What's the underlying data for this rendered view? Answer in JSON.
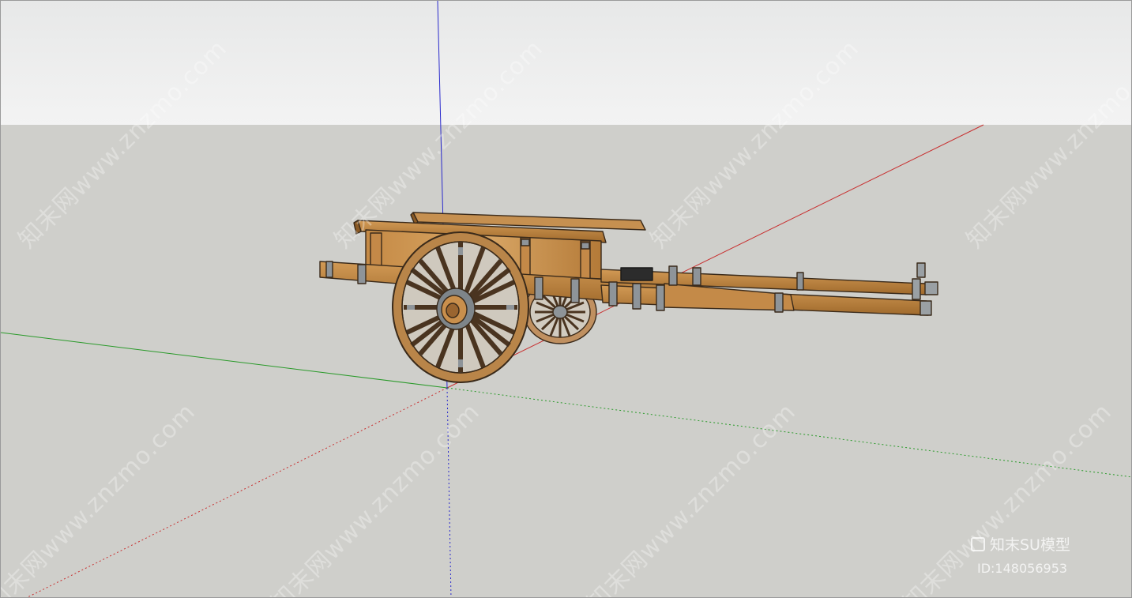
{
  "viewport": {
    "sky_color": "#eeeeee",
    "ground_color": "#cfcfcb"
  },
  "axes": {
    "red": "#cc2222",
    "green": "#22aa22",
    "blue": "#2222cc"
  },
  "model": {
    "wood_color": "#b8863f",
    "metal_color": "#8e9499"
  },
  "watermark": {
    "text": "知末网www.znzmo.com"
  },
  "brand": {
    "name": "知末SU模型",
    "id": "ID:148056953"
  }
}
